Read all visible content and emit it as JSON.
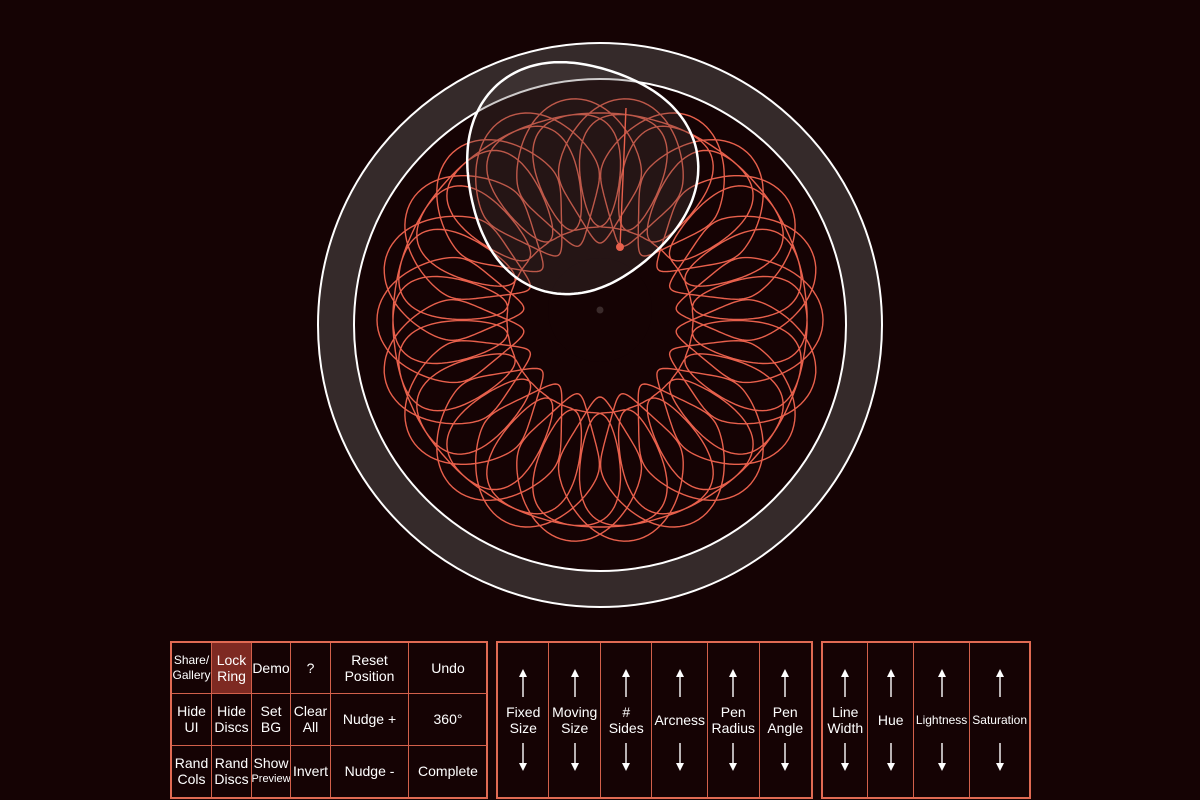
{
  "colors": {
    "background": "#150304",
    "ring_fill": "#352a2a",
    "ring_stroke": "#ffffff",
    "trace": "#e8604c",
    "accent": "#e06a53",
    "active_button": "#7e2a22"
  },
  "toolbar": {
    "row1": [
      {
        "id": "share-gallery-button",
        "label": "Share/\nGallery",
        "active": false,
        "small": true
      },
      {
        "id": "lock-ring-button",
        "label": "Lock\nRing",
        "active": true,
        "small": false
      },
      {
        "id": "demo-button",
        "label": "Demo",
        "active": false,
        "small": false
      },
      {
        "id": "help-button",
        "label": "?",
        "active": false,
        "small": false
      },
      {
        "id": "reset-position-button",
        "label": "Reset\nPosition",
        "active": false,
        "small": false
      },
      {
        "id": "undo-button",
        "label": "Undo",
        "active": false,
        "small": false
      }
    ],
    "row2": [
      {
        "id": "hide-ui-button",
        "label": "Hide\nUI",
        "active": false,
        "small": false
      },
      {
        "id": "hide-discs-button",
        "label": "Hide\nDiscs",
        "active": false,
        "small": false
      },
      {
        "id": "set-bg-button",
        "label": "Set\nBG",
        "active": false,
        "small": false
      },
      {
        "id": "clear-all-button",
        "label": "Clear\nAll",
        "active": false,
        "small": false
      },
      {
        "id": "nudge-plus-button",
        "label": "Nudge +",
        "active": false,
        "small": false
      },
      {
        "id": "rotate-360-button",
        "label": "360°",
        "active": false,
        "small": false
      }
    ],
    "row3": [
      {
        "id": "rand-cols-button",
        "label": "Rand\nCols",
        "active": false,
        "small": false
      },
      {
        "id": "rand-discs-button",
        "label": "Rand\nDiscs",
        "active": false,
        "small": false
      },
      {
        "id": "show-preview-button",
        "label": "Show",
        "label2": "Preview",
        "active": false,
        "small": false
      },
      {
        "id": "invert-button",
        "label": "Invert",
        "active": false,
        "small": false
      },
      {
        "id": "nudge-minus-button",
        "label": "Nudge -",
        "active": false,
        "small": false
      },
      {
        "id": "complete-button",
        "label": "Complete",
        "active": false,
        "small": false
      }
    ]
  },
  "shape_sliders": [
    {
      "id": "fixed-size",
      "label": "Fixed\nSize"
    },
    {
      "id": "moving-size",
      "label": "Moving\nSize"
    },
    {
      "id": "sides",
      "label": "# Sides"
    },
    {
      "id": "arcness",
      "label": "Arcness"
    },
    {
      "id": "pen-radius",
      "label": "Pen\nRadius"
    },
    {
      "id": "pen-angle",
      "label": "Pen\nAngle"
    }
  ],
  "style_sliders": [
    {
      "id": "line-width",
      "label": "Line\nWidth",
      "small": false
    },
    {
      "id": "hue",
      "label": "Hue",
      "small": false
    },
    {
      "id": "lightness",
      "label": "Lightness",
      "small": true
    },
    {
      "id": "saturation",
      "label": "Saturation",
      "small": true
    }
  ]
}
